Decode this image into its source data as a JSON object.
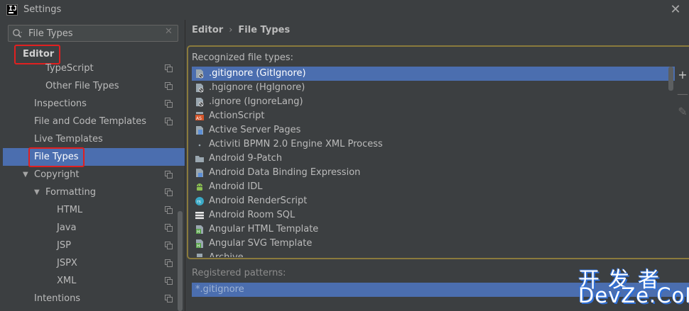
{
  "window": {
    "title": "Settings",
    "close_glyph": "✕",
    "logo_letters": "IJ"
  },
  "search": {
    "value": "File Types",
    "clear_glyph": "✕"
  },
  "tree": {
    "editor_label": "Editor",
    "items": [
      {
        "label": "TypeScript",
        "arrow": "",
        "copy_icon": true
      },
      {
        "label": "Other File Types",
        "arrow": "",
        "copy_icon": true
      },
      {
        "label": "Inspections",
        "arrow": "",
        "copy_icon": true
      },
      {
        "label": "File and Code Templates",
        "arrow": "",
        "copy_icon": true
      },
      {
        "label": "Live Templates",
        "arrow": "",
        "copy_icon": false
      },
      {
        "label": "File Types",
        "arrow": "",
        "copy_icon": false,
        "selected": true
      },
      {
        "label": "Copyright",
        "arrow": "▼",
        "copy_icon": true
      },
      {
        "label": "Formatting",
        "arrow": "▼",
        "copy_icon": true
      },
      {
        "label": "HTML",
        "arrow": "",
        "copy_icon": true
      },
      {
        "label": "Java",
        "arrow": "",
        "copy_icon": true
      },
      {
        "label": "JSP",
        "arrow": "",
        "copy_icon": true
      },
      {
        "label": "JSPX",
        "arrow": "",
        "copy_icon": true
      },
      {
        "label": "XML",
        "arrow": "",
        "copy_icon": true
      },
      {
        "label": "Intentions",
        "arrow": "",
        "copy_icon": true
      }
    ]
  },
  "breadcrumb": {
    "parent": "Editor",
    "separator": "›",
    "current": "File Types"
  },
  "recognized": {
    "label": "Recognized file types:",
    "items": [
      {
        "name": ".gitignore (GitIgnore)",
        "icon": "ignore-file-icon",
        "selected": true
      },
      {
        "name": ".hgignore (HgIgnore)",
        "icon": "ignore-file-icon"
      },
      {
        "name": ".ignore (IgnoreLang)",
        "icon": "ignore-file-icon"
      },
      {
        "name": "ActionScript",
        "icon": "actionscript-icon"
      },
      {
        "name": "Active Server Pages",
        "icon": "asp-file-icon"
      },
      {
        "name": "Activiti BPMN 2.0 Engine XML Process",
        "icon": "bpmn-icon"
      },
      {
        "name": "Android 9-Patch",
        "icon": "folder-icon"
      },
      {
        "name": "Android Data Binding Expression",
        "icon": "data-binding-icon"
      },
      {
        "name": "Android IDL",
        "icon": "android-icon"
      },
      {
        "name": "Android RenderScript",
        "icon": "renderscript-icon"
      },
      {
        "name": "Android Room SQL",
        "icon": "room-sql-icon"
      },
      {
        "name": "Angular HTML Template",
        "icon": "angular-html-icon"
      },
      {
        "name": "Angular SVG Template",
        "icon": "angular-svg-icon"
      },
      {
        "name": "Archive",
        "icon": "archive-icon"
      }
    ]
  },
  "toolbar": {
    "add": "+",
    "remove": "—",
    "edit": "✎"
  },
  "patterns": {
    "label": "Registered patterns:",
    "items": [
      "*.gitignore"
    ]
  },
  "watermark": {
    "line1": "开发者",
    "line2": "DevZe.CoM"
  },
  "colors": {
    "selection": "#4b6eaf",
    "highlight_box": "#e02020",
    "group_border": "#8a7a3c"
  }
}
